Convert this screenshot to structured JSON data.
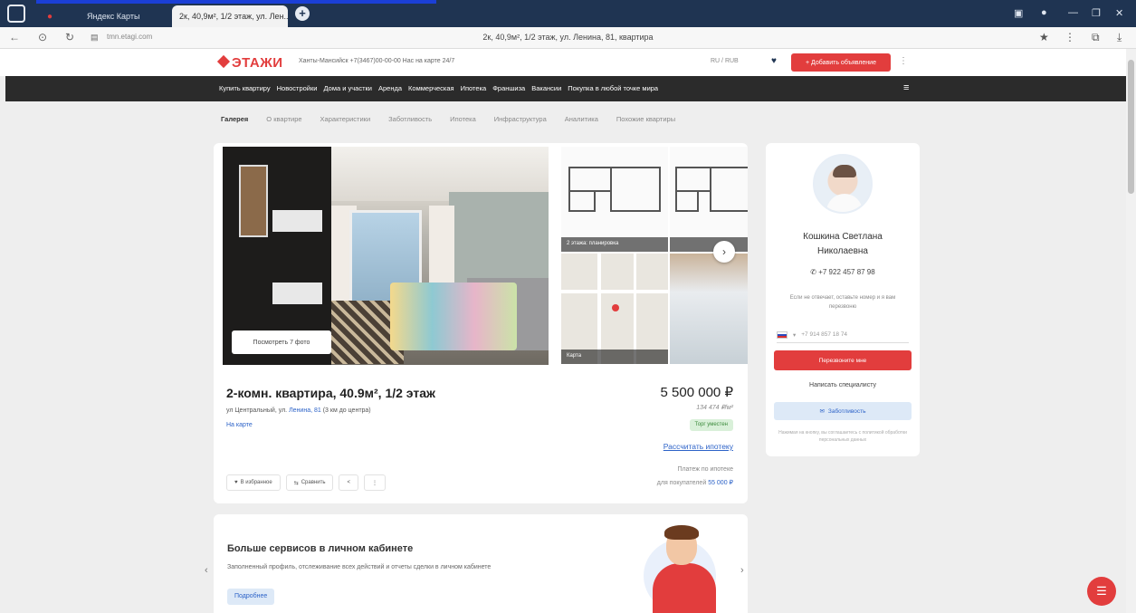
{
  "browser": {
    "tabs": [
      {
        "label": "Яндекс Карты",
        "active": false
      },
      {
        "label": "2к, 40,9м², 1/2 этаж, ул. Лен...",
        "active": true
      }
    ],
    "url": "tmn.etagi.com",
    "page_title": "2к, 40,9м², 1/2 этаж, ул. Ленина, 81, квартира",
    "new_tab": "+"
  },
  "header": {
    "logo": "ЭТАЖИ",
    "city": "Ханты-Мансийск  +7(3467)00-00-00  Нас на карте 24/7",
    "language": "RU / RUB",
    "add_button": "+ Добавить объявление"
  },
  "mainnav": [
    "Купить квартиру",
    "Новостройки",
    "Дома и участки",
    "Аренда",
    "Коммерческая",
    "Ипотека",
    "Франшиза",
    "Вакансии",
    "Покупка в любой точке мира"
  ],
  "subtabs": [
    "Галерея",
    "О квартире",
    "Характеристики",
    "Заботливость",
    "Ипотека",
    "Инфраструктура",
    "Аналитика",
    "Похожие квартиры"
  ],
  "gallery": {
    "view_button": "Посмотреть 7 фото",
    "thumb_caption_1": "2 этажа: планировка",
    "thumb_caption_2": "Карта"
  },
  "listing": {
    "title": "2-комн. квартира, 40.9м², 1/2 этаж",
    "address_prefix": "ул Центральный, ул.",
    "address_link": "Ленина, 81",
    "address_suffix": "(3 км до центра)",
    "map_link": "На карте",
    "price": "5 500 000 ₽",
    "price_per_m": "134 474 ₽/м²",
    "badge": "Торг уместен",
    "calc_link": "Рассчитать ипотеку",
    "loan_line1": "Платеж по ипотеке",
    "loan_line2_prefix": "для покупателей",
    "loan_line2_value": "55 000 ₽",
    "actions": [
      "В избранное",
      "Сравнить",
      "<",
      "⋮"
    ]
  },
  "promo": {
    "title": "Больше сервисов в личном кабинете",
    "text": "Заполненный профиль, отслеживание всех действий и отчеты сделки в личном кабинете",
    "button": "Подробнее"
  },
  "agent": {
    "name_line1": "Кошкина Светлана",
    "name_line2": "Николаевна",
    "phone": "+7 922 457 87 98",
    "note": "Если не отвечает, оставьте номер и я вам перезвоню",
    "input_placeholder": "+7 914 857 18 74",
    "call_button": "Перезвоните мне",
    "write_link": "Написать специалисту",
    "chat_button": "Заботливость",
    "policy": "Нажимая на кнопку, вы соглашаетесь с политикой обработки персональных данных"
  },
  "colors": {
    "brand": "#e23d3d",
    "nav_dark": "#2b2b2b",
    "tabbar": "#1f3452",
    "link": "#2d63c8"
  }
}
